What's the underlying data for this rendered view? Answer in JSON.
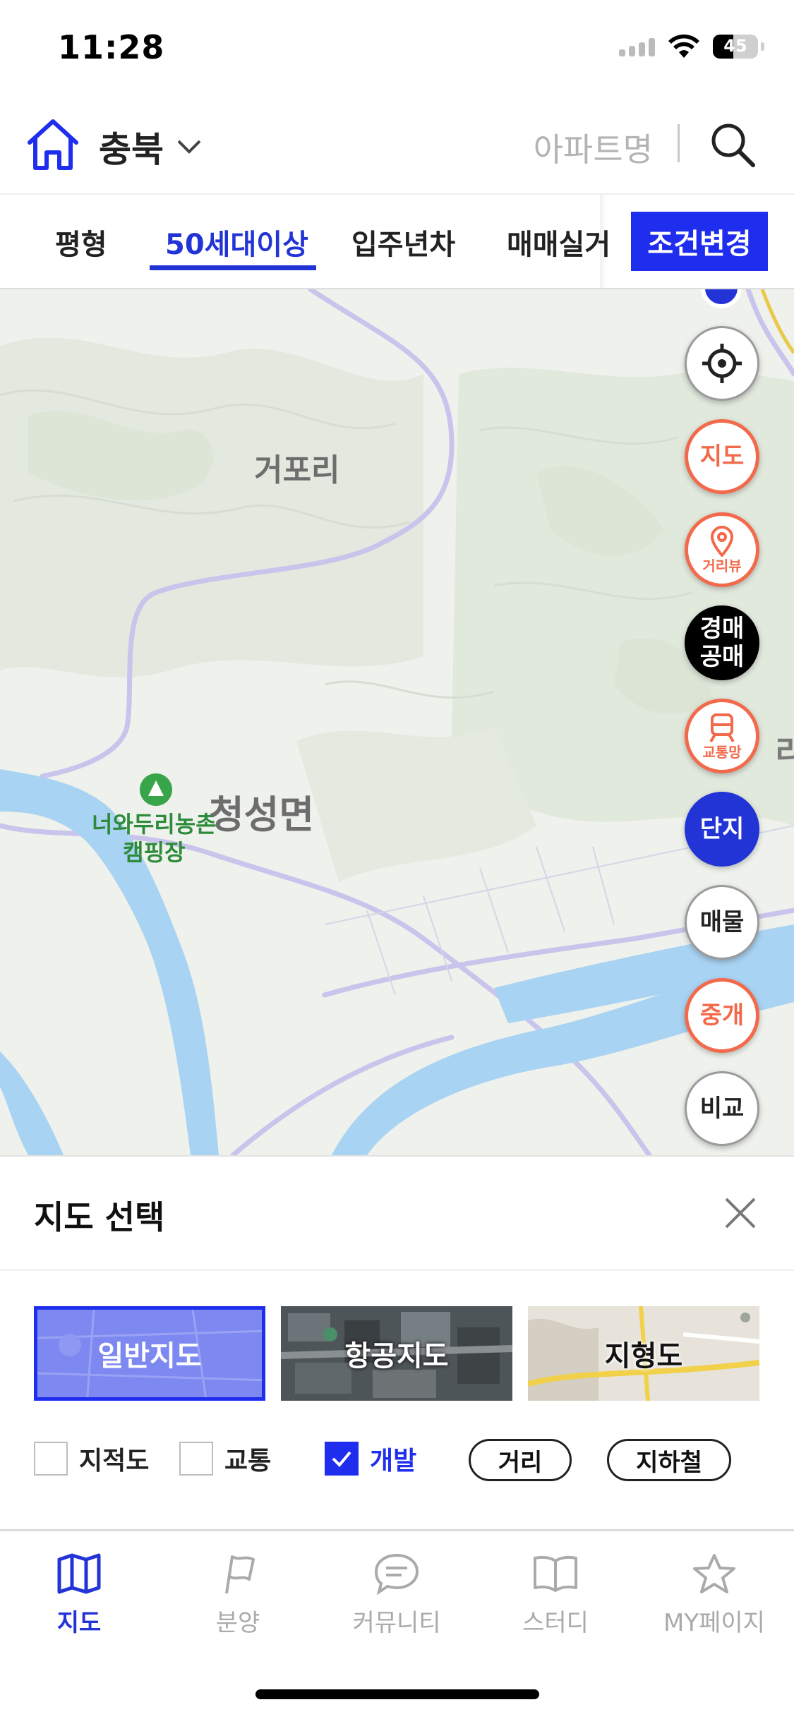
{
  "status_bar": {
    "time": "11:28",
    "battery_level": "45",
    "battery_fraction": 0.45
  },
  "header": {
    "region_label": "충북",
    "search_placeholder": "아파트명",
    "icons": [
      "home-icon",
      "chevron-down-icon",
      "search-icon"
    ]
  },
  "filters": {
    "tabs": [
      {
        "label": "평형",
        "active": false
      },
      {
        "label": "50세대이상",
        "active": true
      },
      {
        "label": "입주년차",
        "active": false
      },
      {
        "label": "매매실거",
        "active": false
      }
    ],
    "condition_button": "조건변경"
  },
  "map": {
    "labels": {
      "village": "거포리",
      "district": "청성면",
      "camping_line1": "너와두리농촌",
      "camping_line2": "캠핑장",
      "partial_ri": "리"
    },
    "controls": [
      {
        "name": "locate-button",
        "icon": "crosshair-icon",
        "label": ""
      },
      {
        "name": "map-layer-button",
        "label": "지도"
      },
      {
        "name": "street-view-button",
        "icon": "location-pin-icon",
        "label": "거리뷰"
      },
      {
        "name": "auction-button",
        "label": "경매\n공매",
        "line1": "경매",
        "line2": "공매"
      },
      {
        "name": "transit-button",
        "icon": "train-icon",
        "label": "교통망"
      },
      {
        "name": "complex-button",
        "label": "단지"
      },
      {
        "name": "listing-button",
        "label": "매물"
      },
      {
        "name": "broker-button",
        "label": "중개"
      },
      {
        "name": "compare-button",
        "label": "비교"
      }
    ]
  },
  "sheet": {
    "title": "지도 선택",
    "map_types": [
      {
        "label": "일반지도",
        "selected": true
      },
      {
        "label": "항공지도",
        "selected": false
      },
      {
        "label": "지형도",
        "selected": false
      }
    ],
    "options": [
      {
        "label": "지적도",
        "checked": false
      },
      {
        "label": "교통",
        "checked": false
      },
      {
        "label": "개발",
        "checked": true
      }
    ],
    "buttons": [
      "거리",
      "지하철"
    ]
  },
  "bottom_nav": {
    "items": [
      {
        "label": "지도",
        "icon": "map-icon",
        "active": true
      },
      {
        "label": "분양",
        "icon": "flag-icon",
        "active": false
      },
      {
        "label": "커뮤니티",
        "icon": "chat-bubble-icon",
        "active": false
      },
      {
        "label": "스터디",
        "icon": "book-icon",
        "active": false
      },
      {
        "label": "MY페이지",
        "icon": "star-icon",
        "active": false
      }
    ]
  },
  "colors": {
    "accent_blue": "#1f2eee",
    "active_tab_blue": "#2234d6",
    "orange": "#f26a4b",
    "river": "#a9d3f2",
    "map_land": "#eef1ec"
  }
}
